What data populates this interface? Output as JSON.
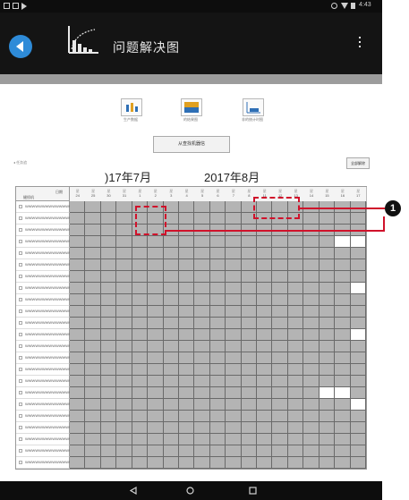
{
  "status_bar": {
    "time": "4:43"
  },
  "app_bar": {
    "title": "问题解决图"
  },
  "graph_buttons": [
    {
      "label": "生产数据",
      "icon": "bar-chart-icon"
    },
    {
      "label": "的结果图",
      "icon": "area-chart-icon"
    },
    {
      "label": "非的统计时图",
      "icon": "line-chart-icon"
    }
  ],
  "detail_button": "从查找机器信",
  "show_all_button": "全部解除",
  "small_label": "◂ 任务追",
  "months": {
    "left": ")17年7月",
    "right": "2017年8月"
  },
  "table": {
    "header_row_label": "缝纫机",
    "header_date_label": "日期",
    "weekday_label": "星",
    "days": [
      "24",
      "25",
      "30",
      "31",
      "1",
      "2",
      "3",
      "4",
      "5",
      "6",
      "7",
      "8",
      "11",
      "12",
      "13",
      "14",
      "15",
      "16",
      "17"
    ],
    "rows": [
      "WWWWWWWWWWWWWWWWWAA",
      "WWWWWWWWWWWWWWWWWAB",
      "WWWWWWWWWWWWWWWWWAC",
      "WWWWWWWWWWWWWWWWWAD",
      "WWWWWWWWWWWWWWWWWAE",
      "WWWWWWWWWWWWWWWWWAF",
      "WWWWWWWWWWWWWWWWWAG",
      "WWWWWWWWWWWWWWWWWAH",
      "WWWWWWWWWWWWWWWWWAI",
      "WWWWWWWWWWWWWWWWWAJ",
      "WWWWWWWWWWWWWWWWWAK",
      "WWWWWWWWWWWWWWWWWAL",
      "WWWWWWWWWWWWWWWWWAM",
      "WWWWWWWWWWWWWWWWWAN",
      "WWWWWWWWWWWWWWWWWAO",
      "WWWWWWWWWWWWWWWWWAP",
      "WWWWWWWWWWWWWWWWWAQ",
      "WWWWWWWWWWWWWWWWWAR",
      "WWWWWWWWWWWWWWWWWAS",
      "WWWWWWWWWWWWWWWWWAT",
      "WWWWWWWWWWWWWWWWWAU",
      "WWWWWWWWWWWWWWWWWAV",
      "WWWWWWWWWWWWWWWWWAW"
    ],
    "white_cells": [
      {
        "row": 3,
        "col": 17
      },
      {
        "row": 3,
        "col": 18
      },
      {
        "row": 7,
        "col": 18
      },
      {
        "row": 11,
        "col": 18
      },
      {
        "row": 16,
        "col": 16
      },
      {
        "row": 16,
        "col": 17
      },
      {
        "row": 17,
        "col": 18
      }
    ]
  },
  "callout_number": "1",
  "colors": {
    "accent_blue": "#2e8bd8",
    "grid_cell_gray": "#b4b4b4",
    "grid_line": "#6a6a6a",
    "highlight_red": "#d0122b"
  }
}
